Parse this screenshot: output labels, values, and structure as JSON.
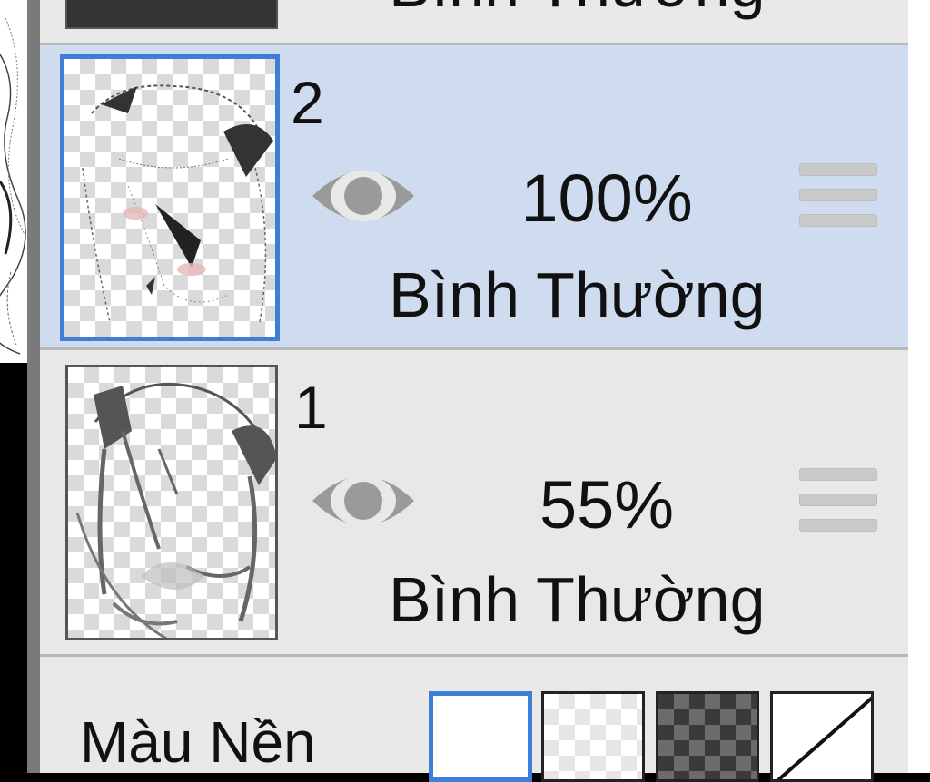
{
  "top_layer": {
    "blend_mode": "Bình Thường"
  },
  "layers": [
    {
      "number": "2",
      "opacity": "100%",
      "blend_mode": "Bình Thường",
      "selected": true,
      "visible": true
    },
    {
      "number": "1",
      "opacity": "55%",
      "blend_mode": "Bình Thường",
      "selected": false,
      "visible": true
    }
  ],
  "background": {
    "label": "Màu Nền",
    "options": [
      "white",
      "light-checker",
      "dark-checker",
      "transparent-none"
    ],
    "selected": "white"
  },
  "colors": {
    "panel": "#e8e8e8",
    "selected_row": "#cfdbee",
    "accent": "#3d7fd6",
    "eye_icon": "#9a9a9a",
    "divider": "#b8b8b8"
  }
}
